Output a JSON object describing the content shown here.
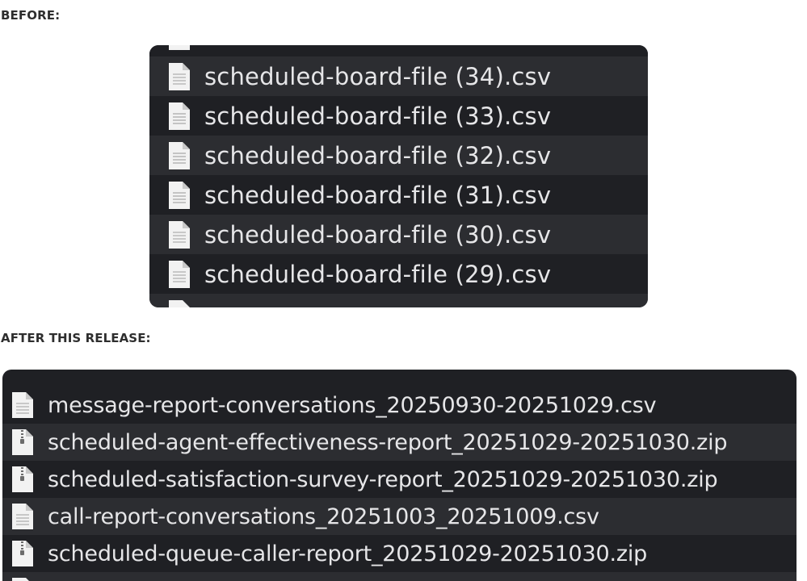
{
  "headings": {
    "before": "BEFORE:",
    "after": "AFTER THIS RELEASE:"
  },
  "before_list": {
    "files": [
      {
        "name": "scheduled-board-file (34).csv",
        "icon": "document-icon"
      },
      {
        "name": "scheduled-board-file (33).csv",
        "icon": "document-icon"
      },
      {
        "name": "scheduled-board-file (32).csv",
        "icon": "document-icon"
      },
      {
        "name": "scheduled-board-file (31).csv",
        "icon": "document-icon"
      },
      {
        "name": "scheduled-board-file (30).csv",
        "icon": "document-icon"
      },
      {
        "name": "scheduled-board-file (29).csv",
        "icon": "document-icon"
      }
    ]
  },
  "after_list": {
    "files": [
      {
        "name": "message-report-conversations_20250930-20251029.csv",
        "icon": "document-icon"
      },
      {
        "name": "scheduled-agent-effectiveness-report_20251029-20251030.zip",
        "icon": "zip-archive-icon"
      },
      {
        "name": "scheduled-satisfaction-survey-report_20251029-20251030.zip",
        "icon": "zip-archive-icon"
      },
      {
        "name": "call-report-conversations_20251003_20251009.csv",
        "icon": "document-icon"
      },
      {
        "name": "scheduled-queue-caller-report_20251029-20251030.zip",
        "icon": "zip-archive-icon"
      }
    ]
  },
  "colors": {
    "panel_background": "#1f2024",
    "row_alternate": "#2c2d31",
    "file_text": "#e6e6e8",
    "icon_fill": "#f2f2f2",
    "heading_text": "#2e2e2e"
  }
}
